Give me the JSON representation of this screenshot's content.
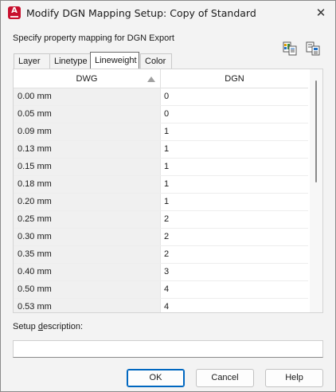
{
  "window": {
    "title": "Modify DGN Mapping Setup: Copy of Standard",
    "close_glyph": "✕",
    "app_icon_glyph": "A"
  },
  "instruction": "Specify property mapping for DGN Export",
  "toolbar": {
    "icons": [
      "import-mapping-icon",
      "export-mapping-icon"
    ]
  },
  "tabs": [
    {
      "label": "Layer",
      "active": false
    },
    {
      "label": "Linetype",
      "active": false
    },
    {
      "label": "Lineweight",
      "active": true
    },
    {
      "label": "Color",
      "active": false
    }
  ],
  "grid": {
    "columns": [
      "DWG",
      "DGN"
    ],
    "sorted_column": "DWG",
    "sort_direction": "ascending",
    "rows": [
      [
        "0.00 mm",
        "0"
      ],
      [
        "0.05 mm",
        "0"
      ],
      [
        "0.09 mm",
        "1"
      ],
      [
        "0.13 mm",
        "1"
      ],
      [
        "0.15 mm",
        "1"
      ],
      [
        "0.18 mm",
        "1"
      ],
      [
        "0.20 mm",
        "1"
      ],
      [
        "0.25 mm",
        "2"
      ],
      [
        "0.30 mm",
        "2"
      ],
      [
        "0.35 mm",
        "2"
      ],
      [
        "0.40 mm",
        "3"
      ],
      [
        "0.50 mm",
        "4"
      ],
      [
        "0.53 mm",
        "4"
      ]
    ]
  },
  "description": {
    "label_prefix": "Setup ",
    "label_accel": "d",
    "label_suffix": "escription:",
    "value": ""
  },
  "buttons": {
    "ok": "OK",
    "cancel": "Cancel",
    "help": "Help"
  },
  "colors": {
    "app_icon": "#c8102e",
    "default_button_border": "#0067c0",
    "background": "#f3f3f3"
  }
}
